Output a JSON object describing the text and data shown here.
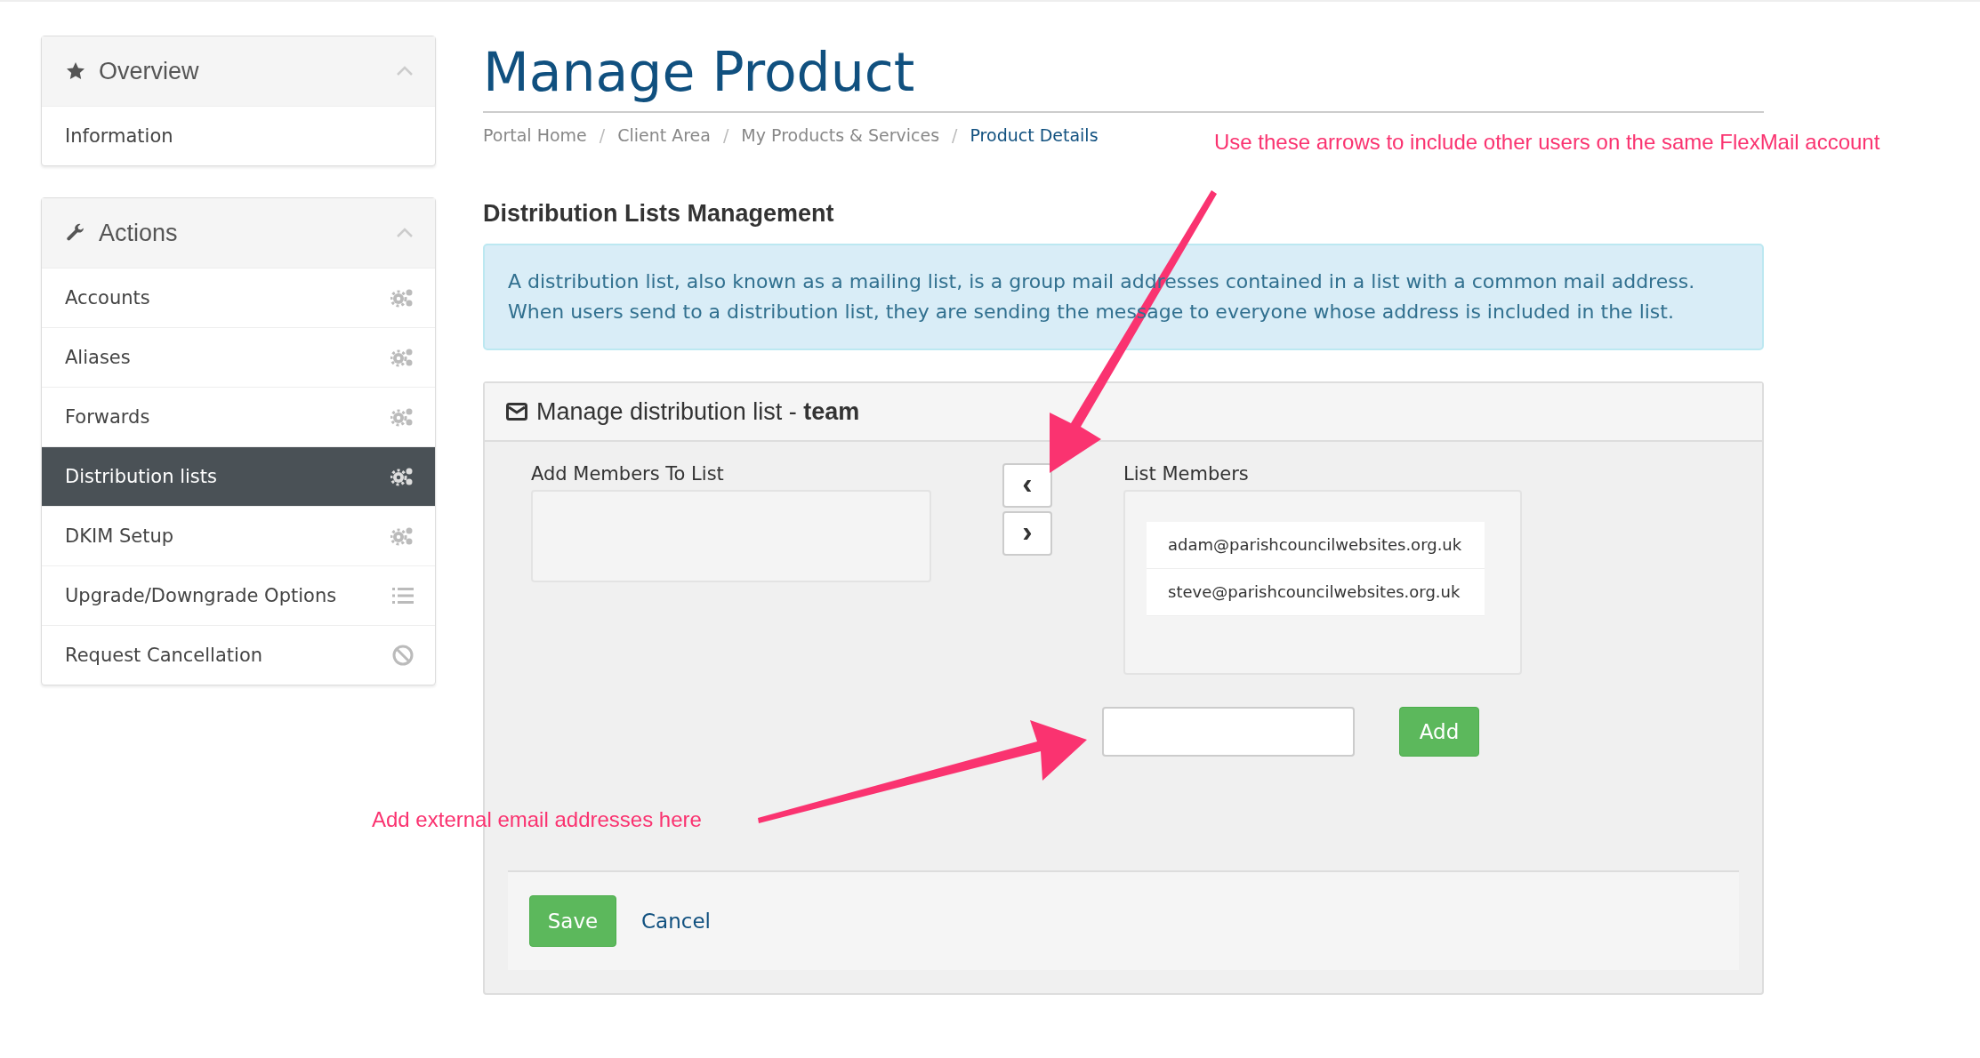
{
  "sidebar": {
    "panels": [
      {
        "title": "Overview",
        "kind": "overview",
        "expanded": true,
        "items": [
          {
            "label": "Information",
            "kind": "plain",
            "selected": false
          }
        ]
      },
      {
        "title": "Actions",
        "kind": "actions",
        "expanded": true,
        "items": [
          {
            "label": "Accounts",
            "kind": "settings",
            "selected": false
          },
          {
            "label": "Aliases",
            "kind": "settings",
            "selected": false
          },
          {
            "label": "Forwards",
            "kind": "settings",
            "selected": false
          },
          {
            "label": "Distribution lists",
            "kind": "settings",
            "selected": true
          },
          {
            "label": "DKIM Setup",
            "kind": "settings",
            "selected": false
          },
          {
            "label": "Upgrade/Downgrade Options",
            "kind": "options",
            "selected": false
          },
          {
            "label": "Request Cancellation",
            "kind": "cancel",
            "selected": false
          }
        ]
      }
    ]
  },
  "page_title": "Manage Product",
  "breadcrumb": [
    {
      "label": "Portal Home",
      "selected": false
    },
    {
      "label": "Client Area",
      "selected": false
    },
    {
      "label": "My Products & Services",
      "selected": false
    },
    {
      "label": "Product Details",
      "selected": true
    }
  ],
  "breadcrumb_separator": "/",
  "section_title": "Distribution Lists Management",
  "info_text": "A distribution list, also known as a mailing list, is a group mail addresses contained in a list with a common mail address. When users send to a distribution list, they are sending the message to everyone whose address is included in the list.",
  "panel": {
    "title": "Manage distribution list - **team**",
    "add_members_label": "Add Members To List",
    "list_members_label": "List Members",
    "list_members": [
      "adam@parishcouncilwebsites.org.uk",
      "steve@parishcouncilwebsites.org.uk"
    ],
    "move_left_label": "‹",
    "move_right_label": "›",
    "add_button": "Add",
    "save_button": "Save",
    "cancel_link": "Cancel"
  },
  "annotations": [
    {
      "text": "Use these arrows to include other users on the same FlexMail account",
      "kind": "top"
    },
    {
      "text": "Add external email addresses here",
      "kind": "bottom"
    }
  ]
}
